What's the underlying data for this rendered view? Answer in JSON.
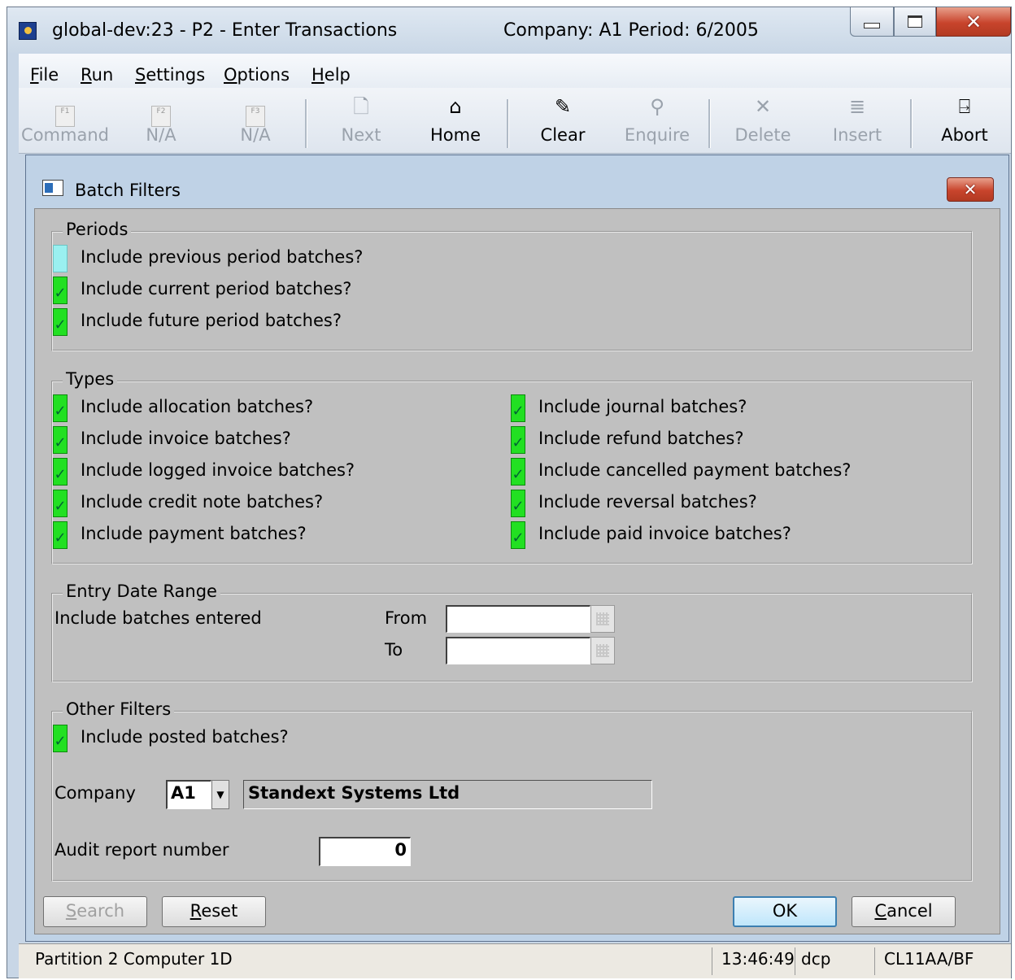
{
  "window": {
    "title": "global-dev:23 - P2 - Enter Transactions",
    "company_period": "Company: A1  Period:  6/2005"
  },
  "menu": [
    {
      "pre": "",
      "mnemonic": "F",
      "post": "ile"
    },
    {
      "pre": "",
      "mnemonic": "R",
      "post": "un"
    },
    {
      "pre": "",
      "mnemonic": "S",
      "post": "ettings"
    },
    {
      "pre": "",
      "mnemonic": "O",
      "post": "ptions"
    },
    {
      "pre": "",
      "mnemonic": "H",
      "post": "elp"
    }
  ],
  "toolbar": {
    "command": "Command",
    "na1": "N/A",
    "na2": "N/A",
    "next": "Next",
    "home": "Home",
    "clear": "Clear",
    "enquire": "Enquire",
    "delete": "Delete",
    "insert": "Insert",
    "abort": "Abort",
    "fkeys": [
      "F1",
      "F2",
      "F3"
    ],
    "icons": {
      "command": "f1-key-icon",
      "na1": "f2-key-icon",
      "na2": "f3-key-icon",
      "next": "next-page-icon",
      "home": "home-icon",
      "clear": "clear-icon",
      "enquire": "magnifier-icon",
      "delete": "x-delete-icon",
      "insert": "insert-icon",
      "abort": "door-exit-icon"
    }
  },
  "dialog": {
    "title": "Batch Filters",
    "periods": {
      "title": "Periods",
      "items": [
        {
          "label": "Include previous period batches?",
          "checked": false
        },
        {
          "label": "Include current period batches?",
          "checked": true
        },
        {
          "label": "Include future period batches?",
          "checked": true
        }
      ]
    },
    "types": {
      "title": "Types",
      "left": [
        {
          "label": "Include allocation batches?",
          "checked": true
        },
        {
          "label": "Include invoice batches?",
          "checked": true
        },
        {
          "label": "Include logged invoice batches?",
          "checked": true
        },
        {
          "label": "Include credit note batches?",
          "checked": true
        },
        {
          "label": "Include payment batches?",
          "checked": true
        }
      ],
      "right": [
        {
          "label": "Include journal batches?",
          "checked": true
        },
        {
          "label": "Include refund batches?",
          "checked": true
        },
        {
          "label": "Include cancelled payment batches?",
          "checked": true
        },
        {
          "label": "Include reversal batches?",
          "checked": true
        },
        {
          "label": "Include paid invoice batches?",
          "checked": true
        }
      ]
    },
    "entry_date": {
      "title": "Entry Date Range",
      "label": "Include batches entered",
      "from_label": "From",
      "to_label": "To",
      "from_value": "",
      "to_value": ""
    },
    "other": {
      "title": "Other Filters",
      "posted": {
        "label": "Include posted batches?",
        "checked": true
      },
      "company_label": "Company",
      "company_code": "A1",
      "company_name": "Standext Systems Ltd",
      "audit_label": "Audit report number",
      "audit_value": "0"
    },
    "buttons": {
      "search": {
        "mnemonic": "S",
        "rest": "earch"
      },
      "reset": {
        "mnemonic": "R",
        "rest": "eset"
      },
      "ok": "OK",
      "cancel": {
        "mnemonic": "C",
        "rest": "ancel"
      }
    }
  },
  "status": {
    "partition": "Partition 2 Computer 1D",
    "time": "13:46:49",
    "user": "dcp",
    "code": "CL11AA/BF"
  },
  "colors": {
    "checkbox_checked": "#22e022",
    "checkbox_unchecked": "#9af0f0",
    "dialog_body": "#c0c0c0"
  }
}
